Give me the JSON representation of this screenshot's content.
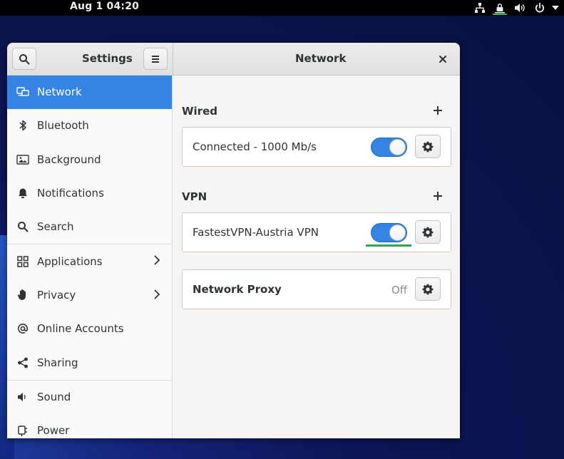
{
  "topbar": {
    "datetime": "Aug 1  04:20",
    "tray_icons": [
      "network-wired-icon",
      "vpn-icon",
      "volume-icon",
      "power-icon",
      "dropdown-arrow-icon"
    ]
  },
  "window": {
    "sidebar_title": "Settings",
    "page_title": "Network"
  },
  "sidebar": {
    "items": [
      {
        "label": "Network",
        "icon": "network-icon",
        "active": true
      },
      {
        "label": "Bluetooth",
        "icon": "bluetooth-icon"
      },
      {
        "label": "Background",
        "icon": "background-icon"
      },
      {
        "label": "Notifications",
        "icon": "bell-icon"
      },
      {
        "label": "Search",
        "icon": "search-icon"
      },
      {
        "label": "Applications",
        "icon": "applications-icon",
        "has_submenu": true
      },
      {
        "label": "Privacy",
        "icon": "hand-icon",
        "has_submenu": true
      },
      {
        "label": "Online Accounts",
        "icon": "at-icon"
      },
      {
        "label": "Sharing",
        "icon": "share-icon"
      },
      {
        "label": "Sound",
        "icon": "speaker-icon"
      },
      {
        "label": "Power",
        "icon": "power-plug-icon"
      }
    ]
  },
  "main": {
    "wired": {
      "title": "Wired",
      "connection_label": "Connected - 1000 Mb/s",
      "enabled": true
    },
    "vpn": {
      "title": "VPN",
      "connection_label": "FastestVPN-Austria VPN",
      "enabled": true
    },
    "proxy": {
      "label": "Network Proxy",
      "state": "Off"
    }
  },
  "colors": {
    "accent": "#3584e4",
    "highlight_green": "#33a54b",
    "topbar": "#000000"
  }
}
